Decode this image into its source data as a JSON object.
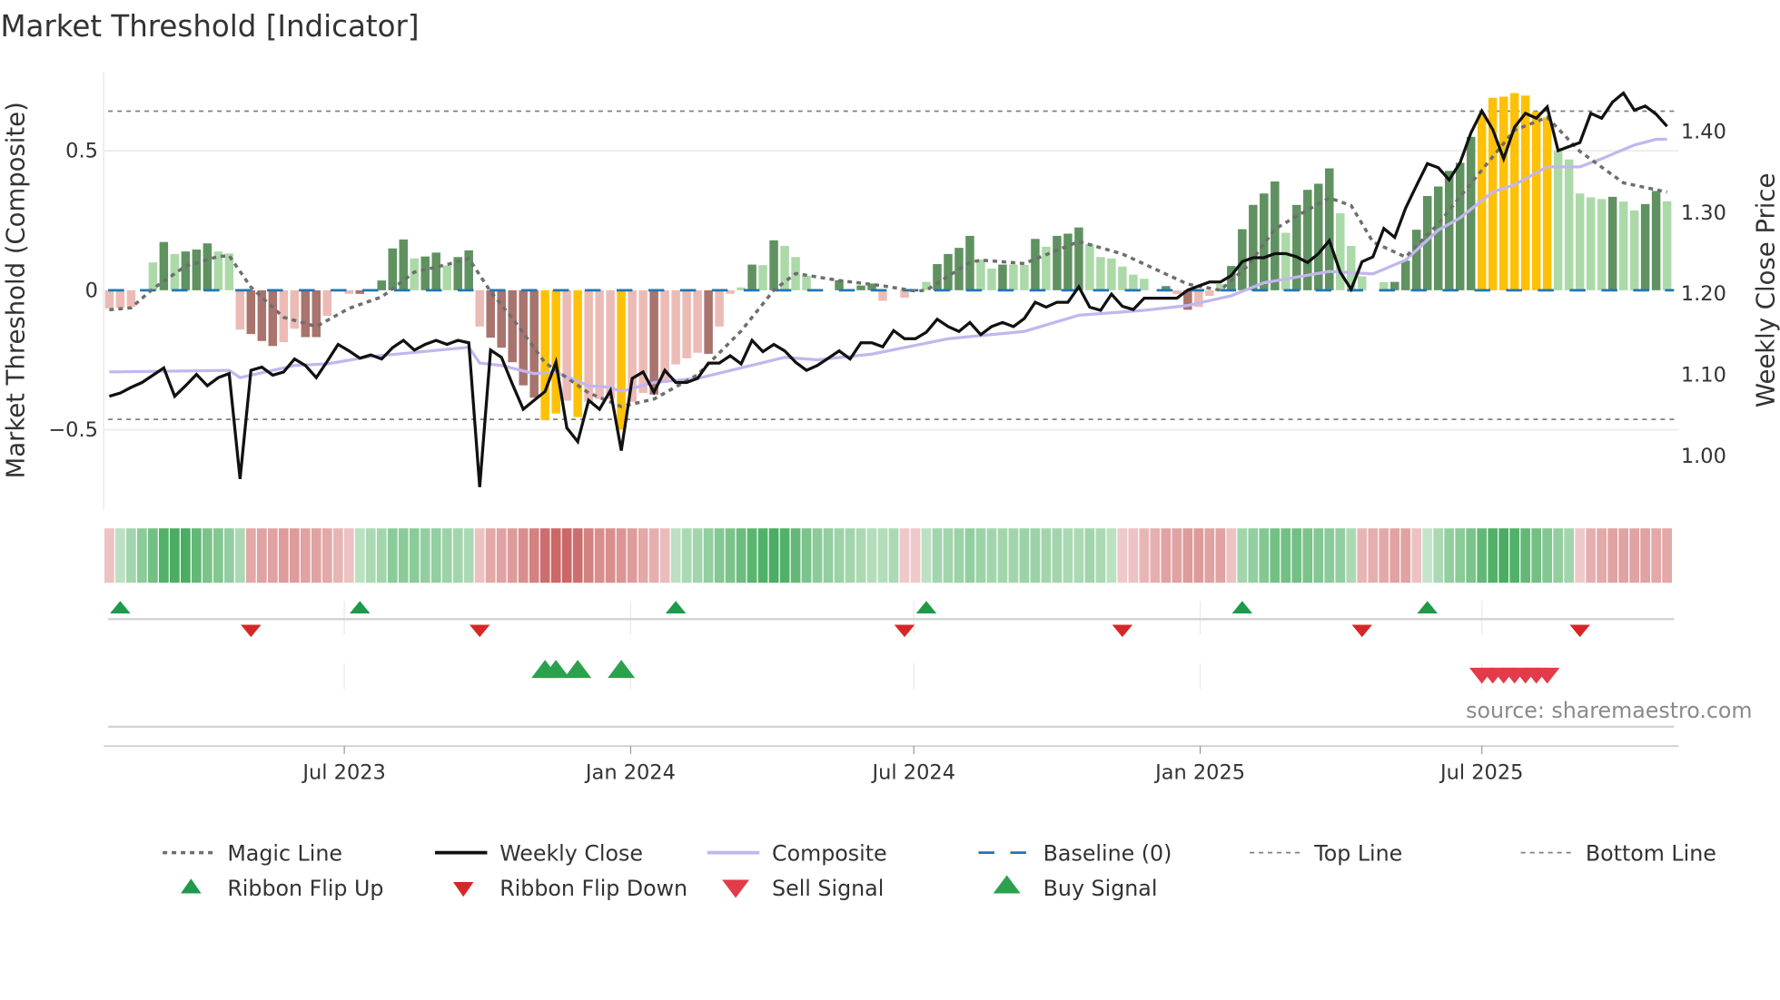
{
  "title": "Market Threshold [Indicator]",
  "source": "source: sharemaestro.com",
  "colors": {
    "bull_strong": "#5f9260",
    "bull_weak": "#acd9a8",
    "bear_weak": "#ecbbb5",
    "bear_strong": "#a9736e",
    "signal": "#ffc107",
    "weekly_close": "#111111",
    "composite": "#c3b6ee",
    "magic": "#6e6e6e",
    "baseline": "#1f77b4",
    "flip_up": "#1e9a4a",
    "flip_down": "#d62728",
    "buy": "#2ca14d",
    "sell": "#e23b4a"
  },
  "chart_data": {
    "type": "bar+line",
    "title": "Market Threshold [Indicator]",
    "start_date": "2023-01-31",
    "frequency": "weekly",
    "ylabel_left": "Market Threshold (Composite)",
    "ylabel_right": "Weekly Close Price",
    "ylim_left": [
      -0.78,
      0.78
    ],
    "ylim_right": [
      0.94,
      1.47
    ],
    "top_line": 0.642,
    "bottom_line": -0.463,
    "baseline": 0,
    "left_ticks": [
      {
        "v": 0.5,
        "label": "0.5"
      },
      {
        "v": 0,
        "label": "0"
      },
      {
        "v": -0.5,
        "label": "−0.5"
      }
    ],
    "right_ticks": [
      {
        "v": 1.4,
        "label": "1.40"
      },
      {
        "v": 1.3,
        "label": "1.30"
      },
      {
        "v": 1.2,
        "label": "1.20"
      },
      {
        "v": 1.1,
        "label": "1.10"
      },
      {
        "v": 1.0,
        "label": "1.00"
      }
    ],
    "x_ticks": [
      {
        "date": "2023-07-01",
        "label": "Jul 2023"
      },
      {
        "date": "2024-01-01",
        "label": "Jan 2024"
      },
      {
        "date": "2024-07-01",
        "label": "Jul 2024"
      },
      {
        "date": "2025-01-01",
        "label": "Jan 2025"
      },
      {
        "date": "2025-07-01",
        "label": "Jul 2025"
      }
    ],
    "bar_class_key": {
      "D": "bull_strong",
      "L": "bull_weak",
      "P": "bear_weak",
      "R": "bear_strong",
      "Y": "signal",
      "N": "none"
    },
    "composite_bars": [
      -0.065,
      -0.063,
      -0.06,
      0,
      0.1,
      0.173,
      0.13,
      0.139,
      0.146,
      0.168,
      0.139,
      0.132,
      -0.141,
      -0.157,
      -0.182,
      -0.2,
      -0.186,
      -0.138,
      -0.168,
      -0.168,
      -0.092,
      0,
      -0.013,
      -0.013,
      0,
      0.035,
      0.15,
      0.182,
      0.114,
      0.121,
      0.135,
      0.089,
      0.119,
      0.143,
      -0.13,
      -0.17,
      -0.206,
      -0.258,
      -0.341,
      -0.385,
      -0.466,
      -0.442,
      -0.396,
      -0.455,
      -0.4,
      -0.39,
      -0.39,
      -0.5,
      -0.4,
      -0.368,
      -0.374,
      -0.33,
      -0.266,
      -0.244,
      -0.224,
      -0.228,
      -0.13,
      -0.013,
      0.01,
      0.092,
      0.09,
      0.179,
      0.159,
      0.119,
      0.052,
      0,
      0,
      0.036,
      0.003,
      0.017,
      0.024,
      -0.038,
      0,
      -0.027,
      0,
      0.03,
      0.094,
      0.13,
      0.152,
      0.195,
      0.11,
      0.078,
      0.092,
      0.092,
      0.091,
      0.184,
      0.156,
      0.195,
      0.203,
      0.225,
      0.165,
      0.119,
      0.114,
      0.085,
      0.056,
      0.041,
      0,
      0.015,
      -0.014,
      -0.07,
      -0.06,
      -0.02,
      0.022,
      0.087,
      0.219,
      0.306,
      0.347,
      0.39,
      0.206,
      0.306,
      0.36,
      0.382,
      0.437,
      0.276,
      0.159,
      0.05,
      0,
      0.029,
      0.03,
      0.106,
      0.217,
      0.338,
      0.372,
      0.428,
      0.457,
      0.55,
      0.63,
      0.69,
      0.694,
      0.707,
      0.698,
      0.64,
      0.62,
      0.5,
      0.469,
      0.347,
      0.333,
      0.327,
      0.335,
      0.318,
      0.286,
      0.309,
      0.356,
      0.319
    ],
    "bar_class": [
      "P",
      "P",
      "P",
      "N",
      "L",
      "D",
      "L",
      "D",
      "D",
      "D",
      "L",
      "L",
      "P",
      "R",
      "R",
      "R",
      "P",
      "P",
      "R",
      "R",
      "P",
      "N",
      "P",
      "R",
      "N",
      "D",
      "D",
      "D",
      "L",
      "D",
      "D",
      "L",
      "D",
      "D",
      "P",
      "R",
      "R",
      "R",
      "R",
      "R",
      "Y",
      "Y",
      "P",
      "Y",
      "P",
      "P",
      "P",
      "Y",
      "P",
      "P",
      "R",
      "P",
      "P",
      "P",
      "P",
      "R",
      "P",
      "P",
      "L",
      "D",
      "L",
      "D",
      "L",
      "L",
      "L",
      "N",
      "N",
      "D",
      "L",
      "D",
      "D",
      "P",
      "N",
      "P",
      "N",
      "L",
      "D",
      "D",
      "D",
      "D",
      "L",
      "L",
      "D",
      "L",
      "L",
      "D",
      "L",
      "D",
      "D",
      "D",
      "L",
      "L",
      "L",
      "L",
      "L",
      "L",
      "N",
      "D",
      "P",
      "R",
      "P",
      "P",
      "L",
      "D",
      "D",
      "D",
      "D",
      "D",
      "L",
      "D",
      "D",
      "D",
      "D",
      "L",
      "L",
      "L",
      "N",
      "L",
      "D",
      "D",
      "D",
      "D",
      "D",
      "D",
      "D",
      "D",
      "Y",
      "Y",
      "Y",
      "Y",
      "Y",
      "Y",
      "Y",
      "L",
      "L",
      "L",
      "L",
      "L",
      "D",
      "L",
      "L",
      "D",
      "D",
      "L"
    ],
    "weekly_close": [
      1.072,
      1.076,
      1.083,
      1.089,
      1.098,
      1.107,
      1.072,
      1.085,
      1.099,
      1.085,
      1.095,
      1.1,
      0.97,
      1.104,
      1.108,
      1.098,
      1.102,
      1.118,
      1.11,
      1.095,
      1.115,
      1.136,
      1.128,
      1.119,
      1.123,
      1.118,
      1.132,
      1.141,
      1.129,
      1.136,
      1.141,
      1.136,
      1.141,
      1.138,
      0.96,
      1.129,
      1.12,
      1.087,
      1.056,
      1.067,
      1.078,
      1.114,
      1.033,
      1.016,
      1.067,
      1.056,
      1.079,
      1.005,
      1.094,
      1.102,
      1.077,
      1.104,
      1.089,
      1.089,
      1.094,
      1.113,
      1.113,
      1.122,
      1.112,
      1.141,
      1.127,
      1.136,
      1.128,
      1.114,
      1.104,
      1.11,
      1.119,
      1.128,
      1.118,
      1.138,
      1.138,
      1.133,
      1.153,
      1.143,
      1.143,
      1.151,
      1.167,
      1.158,
      1.152,
      1.163,
      1.148,
      1.158,
      1.163,
      1.158,
      1.168,
      1.188,
      1.182,
      1.188,
      1.188,
      1.207,
      1.182,
      1.178,
      1.198,
      1.183,
      1.179,
      1.193,
      1.193,
      1.193,
      1.193,
      1.203,
      1.208,
      1.213,
      1.213,
      1.221,
      1.238,
      1.243,
      1.243,
      1.248,
      1.248,
      1.244,
      1.237,
      1.248,
      1.264,
      1.225,
      1.204,
      1.238,
      1.244,
      1.279,
      1.268,
      1.304,
      1.332,
      1.359,
      1.354,
      1.339,
      1.36,
      1.397,
      1.424,
      1.401,
      1.365,
      1.404,
      1.421,
      1.415,
      1.429,
      1.375,
      1.38,
      1.385,
      1.421,
      1.415,
      1.435,
      1.446,
      1.425,
      1.43,
      1.42,
      1.405
    ],
    "composite_line_knots": [
      [
        0,
        1.102
      ],
      [
        11,
        1.104
      ],
      [
        12,
        1.095
      ],
      [
        17,
        1.11
      ],
      [
        20,
        1.112
      ],
      [
        24,
        1.121
      ],
      [
        33,
        1.1325
      ],
      [
        34,
        1.113
      ],
      [
        36,
        1.11
      ],
      [
        39,
        1.1
      ],
      [
        41,
        1.102
      ],
      [
        44,
        1.085
      ],
      [
        46,
        1.083
      ],
      [
        47,
        1.078
      ],
      [
        50,
        1.089
      ],
      [
        54,
        1.094
      ],
      [
        62,
        1.12
      ],
      [
        65,
        1.117
      ],
      [
        70,
        1.124
      ],
      [
        77,
        1.143
      ],
      [
        84,
        1.152
      ],
      [
        89,
        1.172
      ],
      [
        95,
        1.178
      ],
      [
        99,
        1.184
      ],
      [
        103,
        1.196
      ],
      [
        106,
        1.212
      ],
      [
        112,
        1.226
      ],
      [
        116,
        1.223
      ],
      [
        119,
        1.24
      ],
      [
        122,
        1.277
      ],
      [
        124,
        1.292
      ],
      [
        127,
        1.324
      ],
      [
        129,
        1.333
      ],
      [
        132,
        1.355
      ],
      [
        135,
        1.355
      ],
      [
        137,
        1.365
      ],
      [
        140,
        1.382
      ],
      [
        142,
        1.389
      ],
      [
        143,
        1.389
      ]
    ],
    "magic_line_knots": [
      [
        0,
        -0.07
      ],
      [
        2,
        -0.063
      ],
      [
        4,
        0.005
      ],
      [
        7,
        0.087
      ],
      [
        10,
        0.121
      ],
      [
        11,
        0.124
      ],
      [
        13,
        0.011
      ],
      [
        16,
        -0.097
      ],
      [
        19,
        -0.13
      ],
      [
        22,
        -0.065
      ],
      [
        25,
        -0.024
      ],
      [
        28,
        0.065
      ],
      [
        31,
        0.092
      ],
      [
        33,
        0.114
      ],
      [
        35,
        -0.005
      ],
      [
        37,
        -0.1
      ],
      [
        40,
        -0.26
      ],
      [
        44,
        -0.368
      ],
      [
        47,
        -0.417
      ],
      [
        50,
        -0.39
      ],
      [
        54,
        -0.303
      ],
      [
        58,
        -0.146
      ],
      [
        61,
        0
      ],
      [
        63,
        0.06
      ],
      [
        67,
        0.035
      ],
      [
        71,
        0.016
      ],
      [
        74,
        -0.003
      ],
      [
        75,
        0
      ],
      [
        79,
        0.1
      ],
      [
        80,
        0.108
      ],
      [
        84,
        0.096
      ],
      [
        89,
        0.175
      ],
      [
        93,
        0.13
      ],
      [
        99,
        0.022
      ],
      [
        102,
        0
      ],
      [
        104.5,
        0.087
      ],
      [
        107,
        0.219
      ],
      [
        109,
        0.266
      ],
      [
        112,
        0.331
      ],
      [
        114,
        0.304
      ],
      [
        116,
        0.173
      ],
      [
        119,
        0.119
      ],
      [
        122,
        0.238
      ],
      [
        125.6,
        0.412
      ],
      [
        129,
        0.574
      ],
      [
        132,
        0.62
      ],
      [
        135,
        0.498
      ],
      [
        139,
        0.385
      ],
      [
        143,
        0.352
      ]
    ],
    "ribbon_strength": [
      -0.2,
      0.2,
      0.35,
      0.5,
      0.65,
      0.85,
      0.9,
      0.9,
      0.75,
      0.6,
      0.55,
      0.45,
      0.3,
      -0.4,
      -0.45,
      -0.45,
      -0.5,
      -0.5,
      -0.45,
      -0.45,
      -0.4,
      -0.3,
      -0.2,
      0.2,
      0.3,
      0.35,
      0.5,
      0.5,
      0.5,
      0.45,
      0.45,
      0.4,
      0.35,
      0.3,
      -0.2,
      -0.4,
      -0.45,
      -0.5,
      -0.6,
      -0.7,
      -0.85,
      -0.9,
      -0.9,
      -0.85,
      -0.7,
      -0.6,
      -0.6,
      -0.55,
      -0.5,
      -0.4,
      -0.35,
      -0.25,
      0.2,
      0.3,
      0.35,
      0.45,
      0.55,
      0.6,
      0.7,
      0.8,
      0.85,
      0.9,
      0.85,
      0.75,
      0.6,
      0.5,
      0.45,
      0.4,
      0.35,
      0.3,
      0.25,
      0.25,
      0.3,
      -0.15,
      -0.15,
      0.2,
      0.35,
      0.35,
      0.4,
      0.45,
      0.4,
      0.35,
      0.35,
      0.35,
      0.4,
      0.4,
      0.35,
      0.35,
      0.3,
      0.3,
      0.35,
      0.3,
      0.2,
      -0.15,
      -0.2,
      -0.3,
      -0.35,
      -0.45,
      -0.45,
      -0.5,
      -0.5,
      -0.45,
      -0.45,
      -0.2,
      0.35,
      0.45,
      0.55,
      0.65,
      0.65,
      0.65,
      0.6,
      0.55,
      0.5,
      0.45,
      0.3,
      -0.3,
      -0.35,
      -0.4,
      -0.45,
      -0.45,
      -0.2,
      0.15,
      0.3,
      0.45,
      0.5,
      0.6,
      0.75,
      0.85,
      0.9,
      0.85,
      0.75,
      0.65,
      0.55,
      0.45,
      0.35,
      -0.15,
      -0.35,
      -0.4,
      -0.45,
      -0.45,
      -0.45,
      -0.45,
      -0.4,
      -0.4
    ],
    "ribbon_flip_up_weeks": [
      1,
      23,
      52,
      75,
      104,
      121
    ],
    "ribbon_flip_down_weeks": [
      13,
      34,
      73,
      93,
      115,
      135
    ],
    "buy_signal_weeks": [
      40,
      41,
      43,
      47
    ],
    "sell_signal_weeks": [
      126,
      127,
      128,
      129,
      130,
      131,
      132
    ],
    "legend": [
      {
        "key": "magic",
        "label": "Magic Line"
      },
      {
        "key": "close",
        "label": "Weekly Close"
      },
      {
        "key": "composite",
        "label": "Composite"
      },
      {
        "key": "baseline",
        "label": "Baseline (0)"
      },
      {
        "key": "top",
        "label": "Top Line"
      },
      {
        "key": "bottom",
        "label": "Bottom Line"
      },
      {
        "key": "flip_up",
        "label": "Ribbon Flip Up"
      },
      {
        "key": "flip_down",
        "label": "Ribbon Flip Down"
      },
      {
        "key": "sell",
        "label": "Sell Signal"
      },
      {
        "key": "buy",
        "label": "Buy Signal"
      }
    ],
    "legend_placement": "bottom"
  }
}
